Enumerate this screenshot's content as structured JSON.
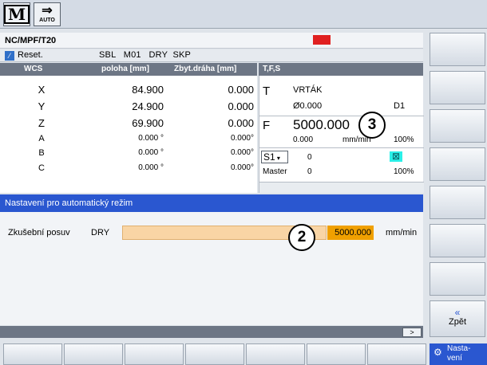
{
  "topbar": {
    "mode_m_label": "M",
    "auto_label": "AUTO",
    "auto_arrow": "⇒"
  },
  "program": {
    "path": "NC/MPF/T20",
    "reset_label": "Reset.",
    "modifiers": "SBL   M01   DRY  SKP",
    "status_color": "#e02020"
  },
  "wcs": {
    "headers": [
      "WCS",
      "poloha [mm]",
      "Zbyt.dráha [mm]"
    ],
    "rows": [
      {
        "axis": "X",
        "position": "84.900",
        "distance": "0.000"
      },
      {
        "axis": "Y",
        "position": "24.900",
        "distance": "0.000"
      },
      {
        "axis": "Z",
        "position": "69.900",
        "distance": "0.000"
      },
      {
        "axis": "A",
        "position": "0.000 °",
        "distance": "0.000°"
      },
      {
        "axis": "B",
        "position": "0.000 °",
        "distance": "0.000°"
      },
      {
        "axis": "C",
        "position": "0.000 °",
        "distance": "0.000°"
      }
    ]
  },
  "tfs": {
    "header": "T,F,S",
    "tool_letter": "T",
    "tool_name": "VRTÁK",
    "tool_diameter": "Ø0.000",
    "tool_edge": "D1",
    "feed_letter": "F",
    "feed_value": "5000.000",
    "feed_actual": "0.000",
    "feed_unit": "mm/min",
    "feed_override": "100%",
    "spindle_label": "S1",
    "spindle_value": "0",
    "spindle_master": "Master",
    "spindle_master_value": "0",
    "spindle_override": "100%",
    "spindle_icon": "spindle-stop-icon"
  },
  "section": {
    "title": "Nastavení pro automatický režim",
    "dry_label": "Zkušební posuv",
    "dry_code": "DRY",
    "dry_value": "5000.000",
    "dry_unit": "mm/min"
  },
  "callouts": {
    "a": "3",
    "b": "2"
  },
  "softkeys": {
    "back_arrow": "«",
    "back_label": "Zpět",
    "settings_label": "Nasta-\nvení",
    "scroll_label": ">"
  },
  "colors": {
    "section_header": "#2a57d0",
    "table_header": "#6d7685",
    "dry_bar": "#f9d5a5",
    "dry_value": "#f0a000"
  }
}
